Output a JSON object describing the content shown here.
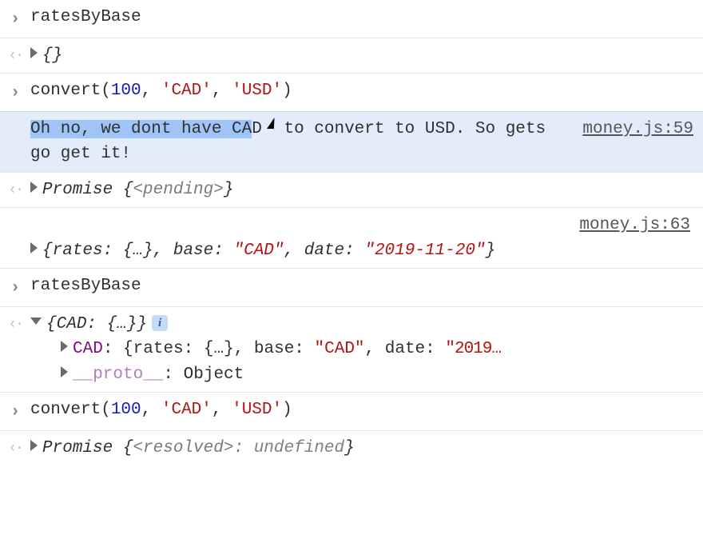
{
  "lines": {
    "l1_input": "ratesByBase",
    "l2_obj": "{}",
    "l3": {
      "fn": "convert",
      "open": "(",
      "arg_num": "100",
      "sep1": ", ",
      "arg_s1": "'CAD'",
      "sep2": ", ",
      "arg_s2": "'USD'",
      "close": ")"
    },
    "l4": {
      "msg_sel": "Oh no, we dont have CA",
      "msg_tail1": "D",
      "msg_tail2": " to convert to USD. So gets go get",
      "msg_tail3": " it!",
      "src": "money.js:59"
    },
    "l5": {
      "promise": "Promise",
      "open": " {",
      "pending": "<pending>",
      "close": "}"
    },
    "l6": {
      "src": "money.js:63",
      "open": "{",
      "k1": "rates: ",
      "v1": "{…}",
      "sep1": ", ",
      "k2": "base: ",
      "v2": "\"CAD\"",
      "sep2": ", ",
      "k3": "date: ",
      "v3": "\"2019-11-20\"",
      "close": "}"
    },
    "l7_input": "ratesByBase",
    "l8": {
      "open": "{",
      "k1": "CAD: ",
      "v1": "{…}",
      "close": "}",
      "info": "i"
    },
    "l9": {
      "key": "CAD",
      "colon": ": ",
      "open": "{",
      "k1": "rates: ",
      "v1": "{…}",
      "sep1": ", ",
      "k2": "base: ",
      "v2": "\"CAD\"",
      "sep2": ", ",
      "k3": "date: ",
      "v3": "\"2019…"
    },
    "l10": {
      "key": "__proto__",
      "colon": ": ",
      "val": "Object"
    },
    "l11": {
      "fn": "convert",
      "open": "(",
      "arg_num": "100",
      "sep1": ", ",
      "arg_s1": "'CAD'",
      "sep2": ", ",
      "arg_s2": "'USD'",
      "close": ")"
    },
    "l12": {
      "promise": "Promise",
      "open": " {",
      "resolved": "<resolved>",
      "colon": ": ",
      "val": "undefined",
      "close": "}"
    }
  },
  "glyphs": {
    "prompt_in": "›",
    "prompt_out": "‹·"
  }
}
